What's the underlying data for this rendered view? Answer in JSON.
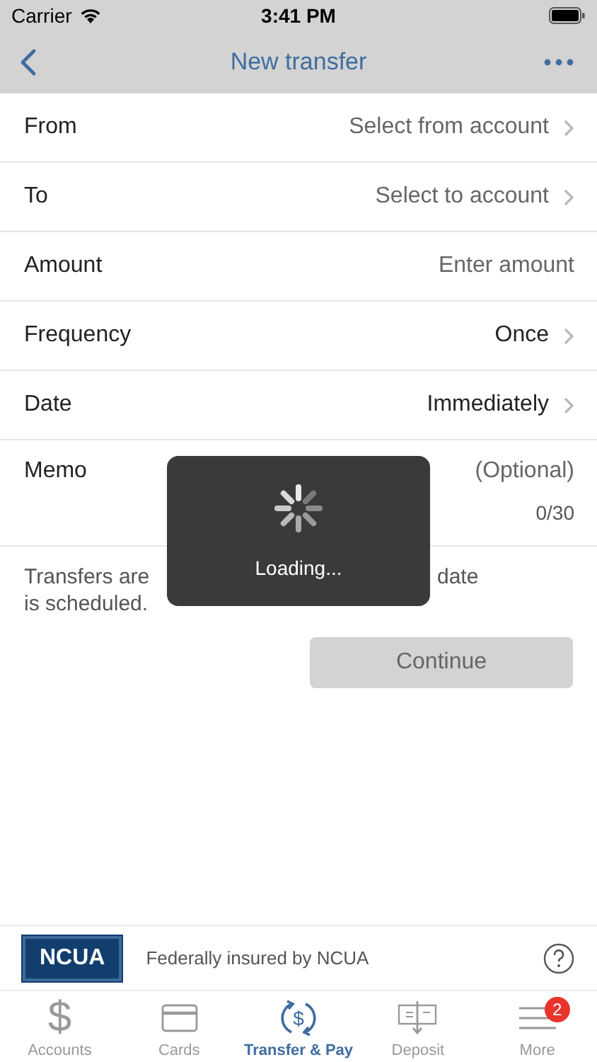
{
  "status_bar": {
    "carrier": "Carrier",
    "time": "3:41 PM"
  },
  "nav": {
    "title": "New transfer"
  },
  "fields": [
    {
      "kind": "select",
      "label": "From",
      "value": "Select from account",
      "filled": false
    },
    {
      "kind": "select",
      "label": "To",
      "value": "Select to account",
      "filled": false
    },
    {
      "kind": "input",
      "label": "Amount",
      "placeholder": "Enter amount"
    },
    {
      "kind": "select",
      "label": "Frequency",
      "value": "Once",
      "filled": true
    },
    {
      "kind": "select",
      "label": "Date",
      "value": "Immediately",
      "filled": true
    },
    {
      "kind": "memo",
      "label": "Memo",
      "placeholder": "(Optional)",
      "counter": "0/30"
    }
  ],
  "note": {
    "line_1_left": "Transfers are",
    "line_1_right": "date",
    "line_2": "is scheduled."
  },
  "continue_button": {
    "label": "Continue",
    "disabled": true
  },
  "loading": {
    "label": "Loading..."
  },
  "footer": {
    "logo": "NCUA",
    "text": "Federally insured by NCUA"
  },
  "tabs": [
    {
      "kind": "dollar",
      "glyph": "$",
      "label": "Accounts",
      "selected": false
    },
    {
      "kind": "card",
      "label": "Cards",
      "selected": false
    },
    {
      "kind": "transfer",
      "glyph": "$",
      "label": "Transfer & Pay",
      "selected": true
    },
    {
      "kind": "deposit",
      "label": "Deposit",
      "selected": false
    },
    {
      "kind": "menu",
      "label": "More",
      "selected": false,
      "badge": "2"
    }
  ]
}
